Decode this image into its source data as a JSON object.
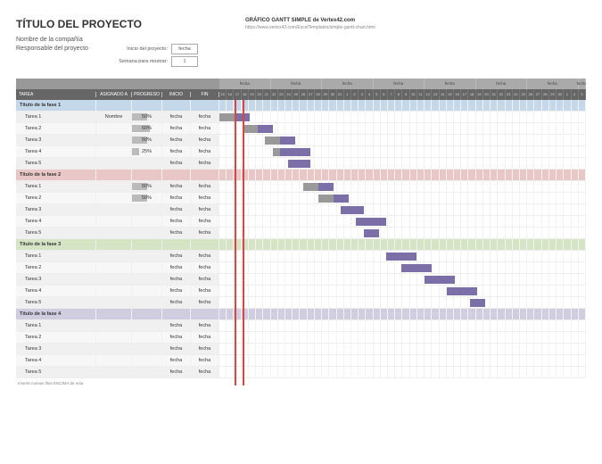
{
  "title": "TÍTULO DEL PROYECTO",
  "company": "Nombre de la compañía",
  "owner": "Responsable del proyecto",
  "meta": {
    "start_lbl": "Inicio del proyecto:",
    "start_val": "fecha",
    "week_lbl": "Semana para mostrar:",
    "week_val": "1"
  },
  "credit": {
    "title": "GRÁFICO GANTT SIMPLE de Vertex42.com",
    "url": "https://www.vertex42.com/ExcelTemplates/simple-gantt-chart.html"
  },
  "cols": {
    "task": "TAREA",
    "assign": "ASIGNADO A",
    "progress": "PROGRESO",
    "start": "INICIO",
    "end": "FIN"
  },
  "week_label": "fecha",
  "days": [
    "15",
    "16",
    "17",
    "18",
    "19",
    "20",
    "21",
    "22",
    "23",
    "24",
    "25",
    "26",
    "27",
    "28",
    "29",
    "30",
    "31",
    "1",
    "2",
    "3",
    "4",
    "5",
    "6",
    "7",
    "8",
    "9",
    "10",
    "11",
    "12",
    "13",
    "14",
    "15",
    "16",
    "17",
    "18",
    "19",
    "20",
    "21",
    "22",
    "23",
    "24",
    "25",
    "26",
    "27",
    "28",
    "29",
    "30",
    "1",
    "2",
    "3"
  ],
  "footer": "Inserte nuevas filas ENCIMA de esta",
  "phases": [
    {
      "name": "Título de la fase 1",
      "cls": "phase1",
      "tasks": [
        {
          "name": "Tarea 1",
          "assign": "Nombre",
          "prog": 50,
          "s": 0,
          "d": 4,
          "done": 2
        },
        {
          "name": "Tarea 2",
          "assign": "",
          "prog": 60,
          "s": 3,
          "d": 4,
          "done": 2
        },
        {
          "name": "Tarea 3",
          "assign": "",
          "prog": 50,
          "s": 6,
          "d": 4,
          "done": 2
        },
        {
          "name": "Tarea 4",
          "assign": "",
          "prog": 25,
          "s": 7,
          "d": 5,
          "done": 1
        },
        {
          "name": "Tarea 5",
          "assign": "",
          "prog": null,
          "s": 9,
          "d": 3,
          "done": 0
        }
      ]
    },
    {
      "name": "Título de la fase 2",
      "cls": "phase2",
      "tasks": [
        {
          "name": "Tarea 1",
          "assign": "",
          "prog": 50,
          "s": 11,
          "d": 4,
          "done": 2
        },
        {
          "name": "Tarea 2",
          "assign": "",
          "prog": 50,
          "s": 13,
          "d": 4,
          "done": 2
        },
        {
          "name": "Tarea 3",
          "assign": "",
          "prog": null,
          "s": 16,
          "d": 3,
          "done": 0
        },
        {
          "name": "Tarea 4",
          "assign": "",
          "prog": null,
          "s": 18,
          "d": 4,
          "done": 0
        },
        {
          "name": "Tarea 5",
          "assign": "",
          "prog": null,
          "s": 19,
          "d": 2,
          "done": 0
        }
      ]
    },
    {
      "name": "Título de la fase 3",
      "cls": "phase3",
      "tasks": [
        {
          "name": "Tarea 1",
          "assign": "",
          "prog": null,
          "s": 22,
          "d": 4,
          "done": 0
        },
        {
          "name": "Tarea 2",
          "assign": "",
          "prog": null,
          "s": 24,
          "d": 4,
          "done": 0
        },
        {
          "name": "Tarea 3",
          "assign": "",
          "prog": null,
          "s": 27,
          "d": 4,
          "done": 0
        },
        {
          "name": "Tarea 4",
          "assign": "",
          "prog": null,
          "s": 30,
          "d": 4,
          "done": 0
        },
        {
          "name": "Tarea 5",
          "assign": "",
          "prog": null,
          "s": 33,
          "d": 2,
          "done": 0
        }
      ]
    },
    {
      "name": "Título de la fase 4",
      "cls": "phase4",
      "tasks": [
        {
          "name": "Tarea 1",
          "assign": "",
          "prog": null,
          "s": null,
          "d": 0,
          "done": 0
        },
        {
          "name": "Tarea 2",
          "assign": "",
          "prog": null,
          "s": null,
          "d": 0,
          "done": 0
        },
        {
          "name": "Tarea 3",
          "assign": "",
          "prog": null,
          "s": null,
          "d": 0,
          "done": 0
        },
        {
          "name": "Tarea 4",
          "assign": "",
          "prog": null,
          "s": null,
          "d": 0,
          "done": 0
        },
        {
          "name": "Tarea 5",
          "assign": "",
          "prog": null,
          "s": null,
          "d": 0,
          "done": 0
        }
      ]
    }
  ],
  "fecha": "fecha"
}
